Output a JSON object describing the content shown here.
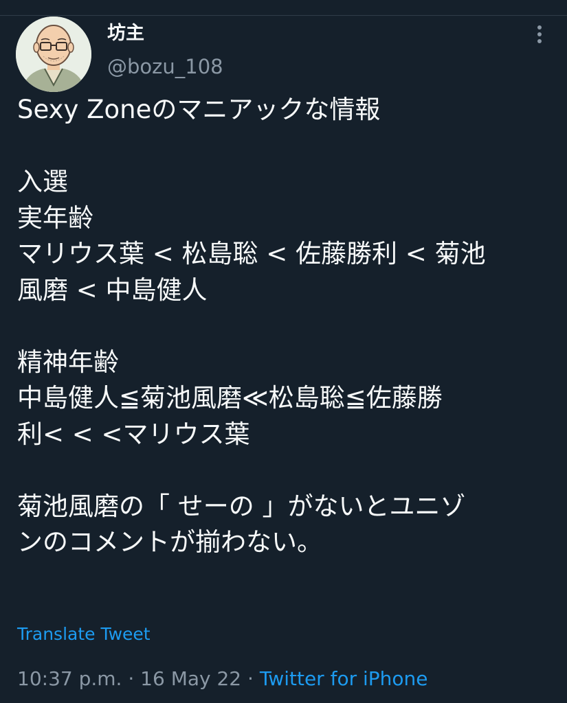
{
  "tweet": {
    "display_name": "坊主",
    "handle": "@bozu_108",
    "more_icon": "more-vertical-icon",
    "lines": [
      "Sexy Zoneのマニアックな情報",
      "",
      "入選",
      "実年齢",
      "マリウス葉 < 松島聡 < 佐藤勝利 < 菊池",
      "風磨 < 中島健人",
      "",
      "精神年齢",
      "中島健人≦菊池風磨≪松島聡≦佐藤勝",
      "利< < <マリウス葉",
      "",
      "菊池風磨の「 せーの 」がないとユニゾ",
      "ンのコメントが揃わない。"
    ],
    "translate_label": "Translate Tweet",
    "time": "10:37 p.m.",
    "separator": "·",
    "date": "16 May 22",
    "source": "Twitter for iPhone"
  },
  "colors": {
    "background": "#15202b",
    "text": "#f7f9f9",
    "secondary_text": "#8b98a5",
    "link": "#1d9bf0"
  }
}
